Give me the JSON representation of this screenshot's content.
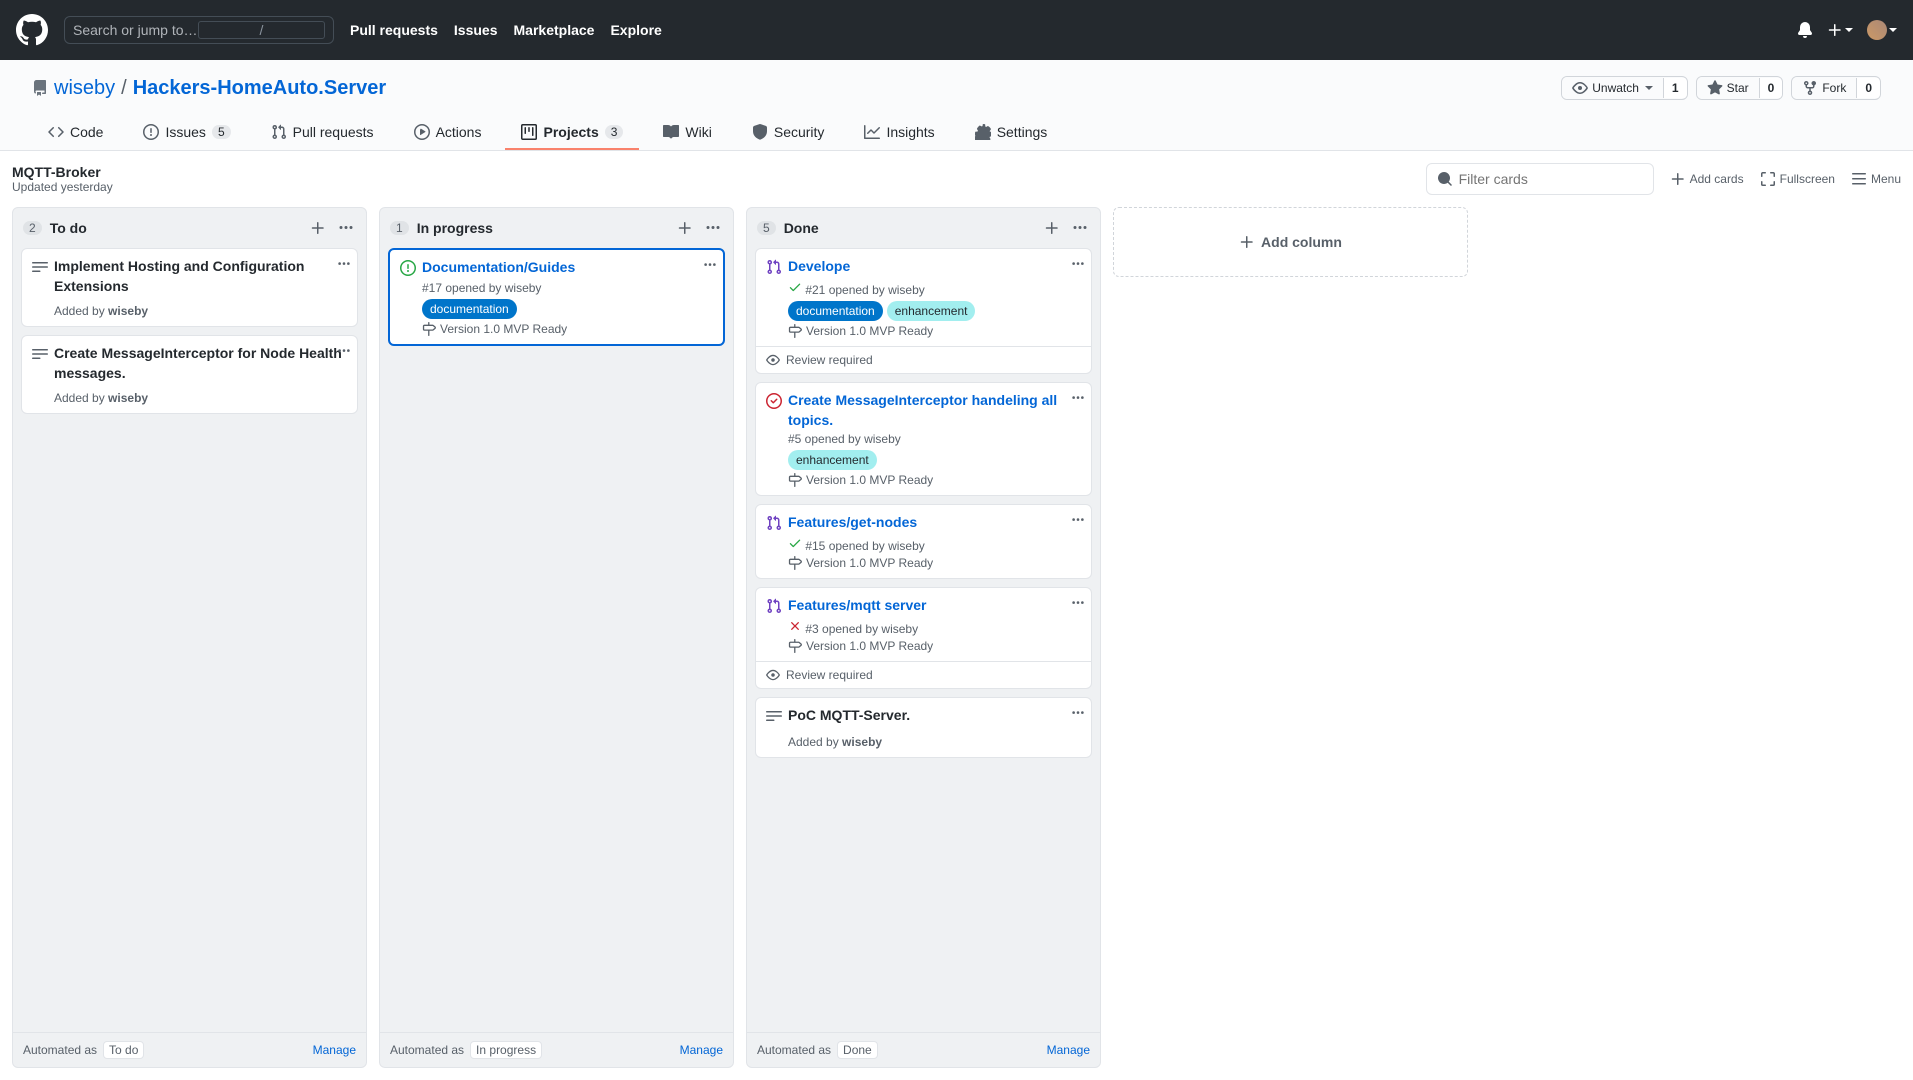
{
  "header": {
    "search_placeholder": "Search or jump to…",
    "nav": [
      "Pull requests",
      "Issues",
      "Marketplace",
      "Explore"
    ]
  },
  "repo": {
    "owner": "wiseby",
    "name": "Hackers-HomeAuto.Server",
    "actions": {
      "watch": "Unwatch",
      "watch_count": "1",
      "star": "Star",
      "star_count": "0",
      "fork": "Fork",
      "fork_count": "0"
    },
    "tabs": {
      "code": "Code",
      "issues": "Issues",
      "issues_count": "5",
      "pulls": "Pull requests",
      "actions": "Actions",
      "projects": "Projects",
      "projects_count": "3",
      "wiki": "Wiki",
      "security": "Security",
      "insights": "Insights",
      "settings": "Settings"
    }
  },
  "project": {
    "name": "MQTT-Broker",
    "updated": "Updated yesterday",
    "filter_placeholder": "Filter cards",
    "add_cards": "Add cards",
    "fullscreen": "Fullscreen",
    "menu": "Menu",
    "add_column": "Add column"
  },
  "col_footer": {
    "prefix": "Automated as",
    "manage": "Manage"
  },
  "columns": [
    {
      "id": "todo",
      "count": "2",
      "title": "To do",
      "automation": "To do",
      "cards": [
        {
          "type": "note",
          "title": "Implement Hosting and Configuration Extensions",
          "added_by": "wiseby",
          "added_prefix": "Added by"
        },
        {
          "type": "note",
          "title": "Create MessageInterceptor for Node Health messages.",
          "added_by": "wiseby",
          "added_prefix": "Added by"
        }
      ]
    },
    {
      "id": "inprogress",
      "count": "1",
      "title": "In progress",
      "automation": "In progress",
      "cards": [
        {
          "type": "issue-open",
          "selected": true,
          "title": "Documentation/Guides",
          "sub": "#17 opened by wiseby",
          "labels": [
            {
              "cls": "lbl-doc",
              "text": "documentation"
            }
          ],
          "milestone": "Version 1.0 MVP Ready"
        }
      ]
    },
    {
      "id": "done",
      "count": "5",
      "title": "Done",
      "automation": "Done",
      "cards": [
        {
          "type": "pr-merged",
          "title": "Develope",
          "sub": "#21 opened by wiseby",
          "status": "check",
          "labels": [
            {
              "cls": "lbl-doc",
              "text": "documentation"
            },
            {
              "cls": "lbl-enh",
              "text": "enhancement"
            }
          ],
          "milestone": "Version 1.0 MVP Ready",
          "review": "Review required"
        },
        {
          "type": "issue-closed",
          "title": "Create MessageInterceptor handeling all topics.",
          "sub": "#5 opened by wiseby",
          "labels": [
            {
              "cls": "lbl-enh",
              "text": "enhancement"
            }
          ],
          "milestone": "Version 1.0 MVP Ready"
        },
        {
          "type": "pr-merged",
          "title": "Features/get-nodes",
          "sub": "#15 opened by wiseby",
          "status": "check",
          "milestone": "Version 1.0 MVP Ready"
        },
        {
          "type": "pr-merged",
          "title": "Features/mqtt server",
          "sub": "#3 opened by wiseby",
          "status": "x",
          "milestone": "Version 1.0 MVP Ready",
          "review": "Review required"
        },
        {
          "type": "note",
          "title": "PoC MQTT-Server.",
          "added_by": "wiseby",
          "added_prefix": "Added by"
        }
      ]
    }
  ]
}
